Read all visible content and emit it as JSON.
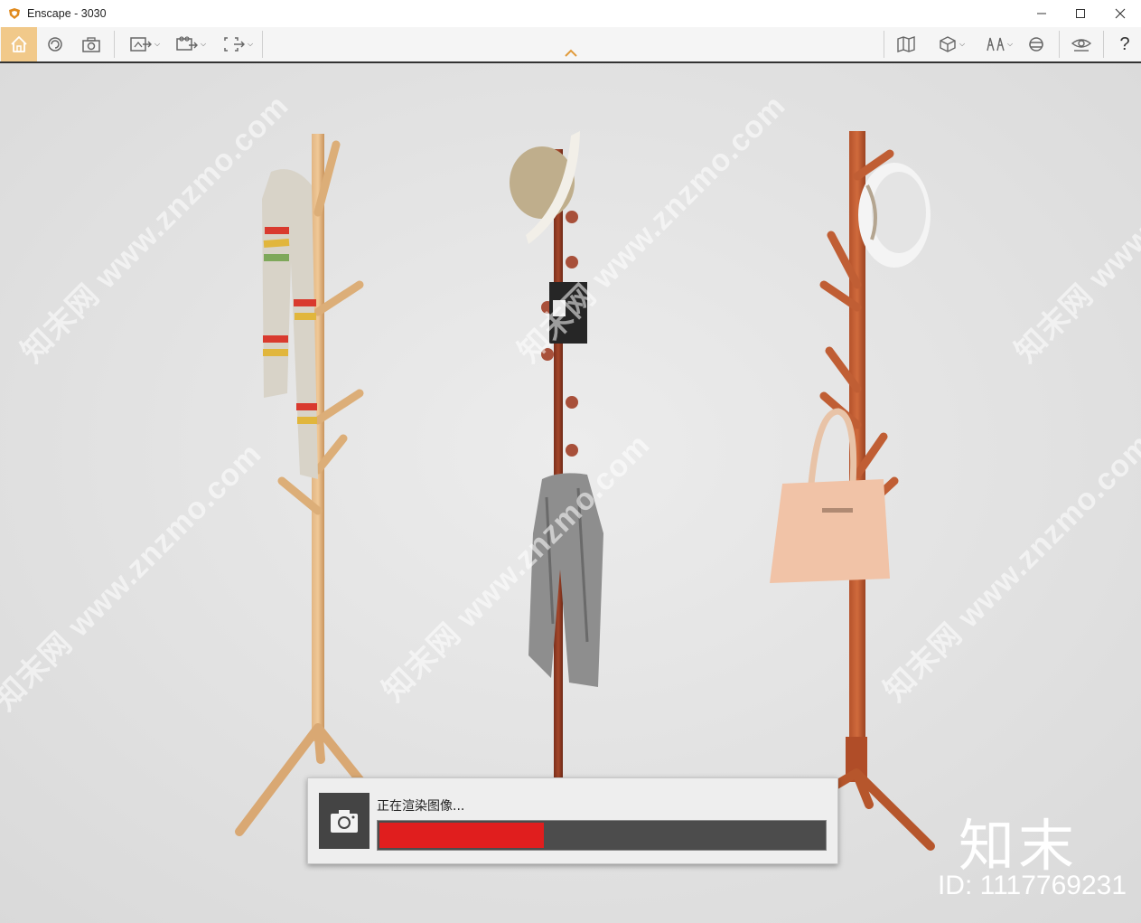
{
  "window": {
    "title": "Enscape - 3030",
    "controls": [
      "minimize",
      "maximize",
      "close"
    ]
  },
  "toolbar": {
    "left_tools": [
      {
        "icon": "home-icon",
        "active": true
      },
      {
        "icon": "orbit-icon"
      },
      {
        "icon": "screenshot-icon"
      },
      {
        "icon": "render-export-icon",
        "dropdown": true
      },
      {
        "icon": "video-export-icon",
        "dropdown": true
      },
      {
        "icon": "batch-export-icon",
        "dropdown": true
      }
    ],
    "right_tools": [
      {
        "icon": "map-icon"
      },
      {
        "icon": "asset-cube-icon",
        "dropdown": true
      },
      {
        "icon": "views-icon",
        "dropdown": true
      },
      {
        "icon": "vr-headset-icon"
      },
      {
        "icon": "visibility-icon"
      },
      {
        "icon": "help-icon",
        "label": "?"
      }
    ],
    "accent_color": "#f1c98a"
  },
  "viewport": {
    "watermark_text": "知末网 www.znzmo.com",
    "brand_logo": "知末",
    "brand_id": "ID: 1117769231"
  },
  "render": {
    "status_text": "正在渲染图像...",
    "progress": 0.37,
    "bar_color": "#e01e1e"
  }
}
